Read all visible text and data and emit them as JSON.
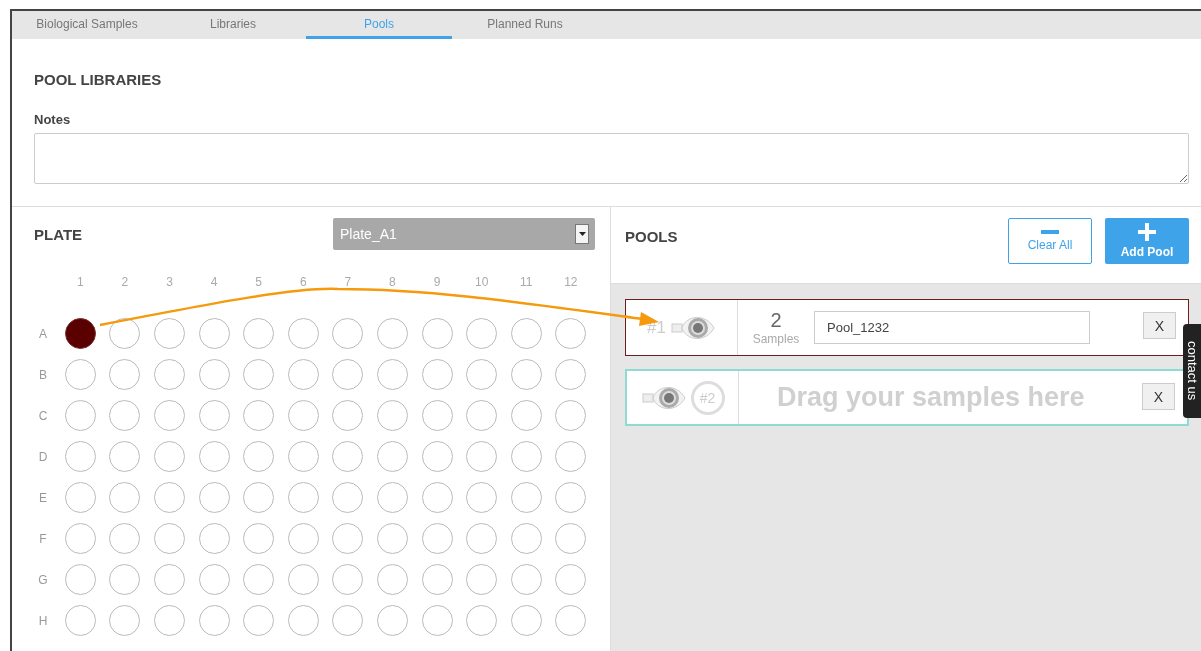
{
  "tabs": [
    {
      "label": "Biological Samples",
      "selected": false
    },
    {
      "label": "Libraries",
      "selected": false
    },
    {
      "label": "Pools",
      "selected": true
    },
    {
      "label": "Planned Runs",
      "selected": false
    }
  ],
  "pool_libraries": {
    "title": "POOL LIBRARIES",
    "notes_label": "Notes"
  },
  "plate": {
    "title": "PLATE",
    "selector": "Plate_A1",
    "columns": [
      "1",
      "2",
      "3",
      "4",
      "5",
      "6",
      "7",
      "8",
      "9",
      "10",
      "11",
      "12"
    ],
    "rows": [
      {
        "label": "A",
        "wells": [
          {
            "filled": true
          },
          {
            "filled": false
          },
          {
            "filled": false
          },
          {
            "filled": false
          },
          {
            "filled": false
          },
          {
            "filled": false
          },
          {
            "filled": false
          },
          {
            "filled": false
          },
          {
            "filled": false
          },
          {
            "filled": false
          },
          {
            "filled": false
          },
          {
            "filled": false
          }
        ]
      },
      {
        "label": "B",
        "wells": [
          {
            "filled": false
          },
          {
            "filled": false
          },
          {
            "filled": false
          },
          {
            "filled": false
          },
          {
            "filled": false
          },
          {
            "filled": false
          },
          {
            "filled": false
          },
          {
            "filled": false
          },
          {
            "filled": false
          },
          {
            "filled": false
          },
          {
            "filled": false
          },
          {
            "filled": false
          }
        ]
      },
      {
        "label": "C",
        "wells": [
          {
            "filled": false
          },
          {
            "filled": false
          },
          {
            "filled": false
          },
          {
            "filled": false
          },
          {
            "filled": false
          },
          {
            "filled": false
          },
          {
            "filled": false
          },
          {
            "filled": false
          },
          {
            "filled": false
          },
          {
            "filled": false
          },
          {
            "filled": false
          },
          {
            "filled": false
          }
        ]
      },
      {
        "label": "D",
        "wells": [
          {
            "filled": false
          },
          {
            "filled": false
          },
          {
            "filled": false
          },
          {
            "filled": false
          },
          {
            "filled": false
          },
          {
            "filled": false
          },
          {
            "filled": false
          },
          {
            "filled": false
          },
          {
            "filled": false
          },
          {
            "filled": false
          },
          {
            "filled": false
          },
          {
            "filled": false
          }
        ]
      },
      {
        "label": "E",
        "wells": [
          {
            "filled": false
          },
          {
            "filled": false
          },
          {
            "filled": false
          },
          {
            "filled": false
          },
          {
            "filled": false
          },
          {
            "filled": false
          },
          {
            "filled": false
          },
          {
            "filled": false
          },
          {
            "filled": false
          },
          {
            "filled": false
          },
          {
            "filled": false
          },
          {
            "filled": false
          }
        ]
      },
      {
        "label": "F",
        "wells": [
          {
            "filled": false
          },
          {
            "filled": false
          },
          {
            "filled": false
          },
          {
            "filled": false
          },
          {
            "filled": false
          },
          {
            "filled": false
          },
          {
            "filled": false
          },
          {
            "filled": false
          },
          {
            "filled": false
          },
          {
            "filled": false
          },
          {
            "filled": false
          },
          {
            "filled": false
          }
        ]
      },
      {
        "label": "G",
        "wells": [
          {
            "filled": false
          },
          {
            "filled": false
          },
          {
            "filled": false
          },
          {
            "filled": false
          },
          {
            "filled": false
          },
          {
            "filled": false
          },
          {
            "filled": false
          },
          {
            "filled": false
          },
          {
            "filled": false
          },
          {
            "filled": false
          },
          {
            "filled": false
          },
          {
            "filled": false
          }
        ]
      },
      {
        "label": "H",
        "wells": [
          {
            "filled": false
          },
          {
            "filled": false
          },
          {
            "filled": false
          },
          {
            "filled": false
          },
          {
            "filled": false
          },
          {
            "filled": false
          },
          {
            "filled": false
          },
          {
            "filled": false
          },
          {
            "filled": false
          },
          {
            "filled": false
          },
          {
            "filled": false
          },
          {
            "filled": false
          }
        ]
      }
    ]
  },
  "pools": {
    "title": "POOLS",
    "clear_button": "Clear All",
    "add_button": "Add Pool",
    "items": [
      {
        "kind": "filled",
        "number": "#1",
        "count": "2",
        "count_label": "Samples",
        "name": "Pool_1232",
        "remove": "X"
      },
      {
        "kind": "empty",
        "number": "#2",
        "hint": "Drag your samples here",
        "remove": "X"
      }
    ]
  },
  "contact_tab": "contact us"
}
